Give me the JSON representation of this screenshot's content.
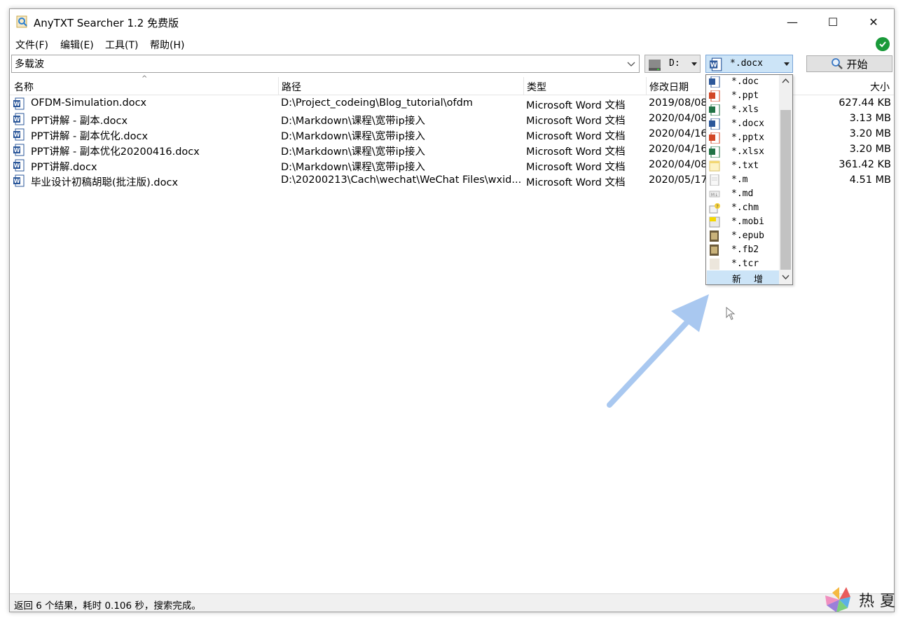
{
  "window": {
    "title": "AnyTXT Searcher 1.2 免费版",
    "controls": {
      "minimize": "—",
      "maximize": "☐",
      "close": "✕"
    }
  },
  "menu": [
    "文件(F)",
    "编辑(E)",
    "工具(T)",
    "帮助(H)"
  ],
  "toolbar": {
    "search_value": "多载波",
    "drive_value": "D:",
    "type_value": "*.docx",
    "start_label": "开始"
  },
  "table": {
    "columns": [
      "名称",
      "路径",
      "类型",
      "修改日期",
      "大小"
    ],
    "rows": [
      {
        "name": "OFDM-Simulation.docx",
        "path": "D:\\Project_codeing\\Blog_tutorial\\ofdm",
        "type": "Microsoft Word 文档",
        "date": "2019/08/08",
        "size": "627.44 KB"
      },
      {
        "name": "PPT讲解 - 副本.docx",
        "path": "D:\\Markdown\\课程\\宽带ip接入",
        "type": "Microsoft Word 文档",
        "date": "2020/04/08",
        "size": "3.13 MB"
      },
      {
        "name": "PPT讲解 - 副本优化.docx",
        "path": "D:\\Markdown\\课程\\宽带ip接入",
        "type": "Microsoft Word 文档",
        "date": "2020/04/16",
        "size": "3.20 MB"
      },
      {
        "name": "PPT讲解 - 副本优化20200416.docx",
        "path": "D:\\Markdown\\课程\\宽带ip接入",
        "type": "Microsoft Word 文档",
        "date": "2020/04/16",
        "size": "3.20 MB"
      },
      {
        "name": "PPT讲解.docx",
        "path": "D:\\Markdown\\课程\\宽带ip接入",
        "type": "Microsoft Word 文档",
        "date": "2020/04/08",
        "size": "361.42 KB"
      },
      {
        "name": "毕业设计初稿胡聪(批注版).docx",
        "path": "D:\\20200213\\Cach\\wechat\\WeChat Files\\wxid...",
        "type": "Microsoft Word 文档",
        "date": "2020/05/17",
        "size": "4.51 MB"
      }
    ]
  },
  "dropdown": {
    "items": [
      {
        "label": "*.doc",
        "icon": "word-icon"
      },
      {
        "label": "*.ppt",
        "icon": "ppt-icon"
      },
      {
        "label": "*.xls",
        "icon": "excel-icon"
      },
      {
        "label": "*.docx",
        "icon": "word-icon"
      },
      {
        "label": "*.pptx",
        "icon": "ppt-icon"
      },
      {
        "label": "*.xlsx",
        "icon": "excel-icon"
      },
      {
        "label": "*.txt",
        "icon": "txt-icon"
      },
      {
        "label": "*.m",
        "icon": "file-icon"
      },
      {
        "label": "*.md",
        "icon": "md-icon"
      },
      {
        "label": "*.chm",
        "icon": "chm-icon"
      },
      {
        "label": "*.mobi",
        "icon": "mobi-icon"
      },
      {
        "label": "*.epub",
        "icon": "book-icon"
      },
      {
        "label": "*.fb2",
        "icon": "book-icon"
      },
      {
        "label": "*.tcr",
        "icon": "file-icon"
      }
    ],
    "new_label": "新增"
  },
  "status": "返回 6 个结果，耗时 0.106 秒，搜索完成。",
  "watermark": "热夏",
  "colors": {
    "word": "#2b579a",
    "ppt": "#d24726",
    "excel": "#217346",
    "selection": "#cce4f7",
    "ok": "#1a9a3a",
    "arrow": "#a9c8f0"
  }
}
